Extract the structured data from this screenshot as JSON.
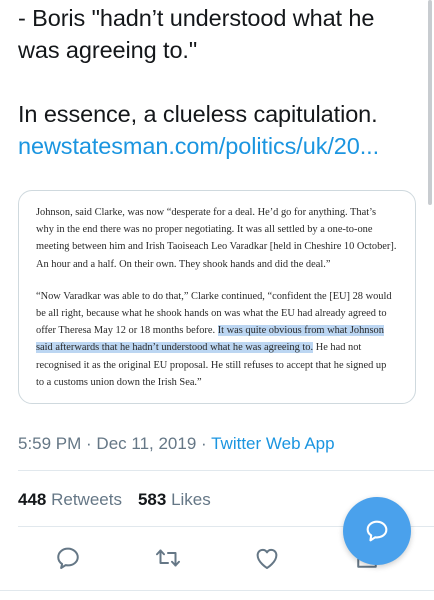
{
  "tweet": {
    "lines": [
      "- Boris \"hadn’t understood what he",
      "was agreeing to.\"",
      "In essence, a clueless capitulation."
    ],
    "link": "newstatesman.com/politics/uk/20..."
  },
  "card": {
    "p1": [
      "Johnson, said Clarke, was now “desperate for a deal. He’d go for anything. That’s",
      "why in the end there was no proper negotiating. It was all settled by a one-to-one",
      "meeting between him and Irish Taoiseach Leo Varadkar [held in Cheshire 10 October].",
      "An hour and a half. On their own. They shook hands and did the deal.”"
    ],
    "p2": {
      "l1": "“Now Varadkar was able to do that,” Clarke continued, “confident the [EU] 28 would",
      "l2": "be all right, because what he shook hands on was what the EU had already agreed to",
      "l3_plain": "offer Theresa May 12 or 18 months before. ",
      "l3_hl": "It was quite obvious from what Johnson",
      "l4_hl": "said afterwards that he hadn’t understood what he was agreeing to.",
      "l4_plain": " He had not",
      "l5": "recognised it as the original EU proposal. He still refuses to accept that he signed up",
      "l6": "to a customs union down the Irish Sea.”"
    }
  },
  "meta": {
    "time": "5:59 PM",
    "sep1": " · ",
    "date": "Dec 11, 2019",
    "sep2": " · ",
    "app": "Twitter Web App"
  },
  "stats": {
    "retweets_count": "448",
    "retweets_label": " Retweets",
    "likes_count": "583",
    "likes_label": " Likes"
  },
  "actions": [
    "reply-icon",
    "retweet-icon",
    "like-icon",
    "share-icon"
  ],
  "colors": {
    "link": "#1b95e0",
    "muted": "#657786",
    "highlight": "#bcd6f2",
    "fab": "#4aa1ec"
  }
}
